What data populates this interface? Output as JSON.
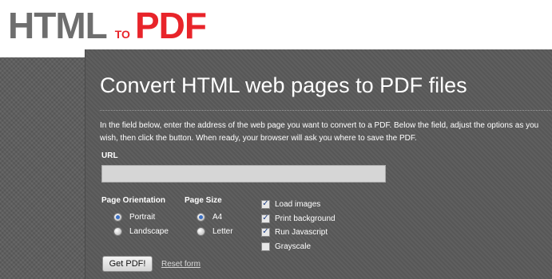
{
  "logo": {
    "html": "HTML",
    "to": "TO",
    "pdf": "PDF"
  },
  "main": {
    "title": "Convert HTML web pages to PDF files",
    "intro": "In the field below, enter the address of the web page you want to convert to a PDF. Below the field, adjust the options as you wish, then click the button. When ready, your browser will ask you where to save the PDF."
  },
  "form": {
    "url_label": "URL",
    "url_value": "",
    "orientation": {
      "label": "Page Orientation",
      "options": [
        {
          "label": "Portrait",
          "selected": true
        },
        {
          "label": "Landscape",
          "selected": false
        }
      ]
    },
    "size": {
      "label": "Page Size",
      "options": [
        {
          "label": "A4",
          "selected": true
        },
        {
          "label": "Letter",
          "selected": false
        }
      ]
    },
    "checkboxes": [
      {
        "label": "Load images",
        "checked": true
      },
      {
        "label": "Print background",
        "checked": true
      },
      {
        "label": "Run Javascript",
        "checked": true
      },
      {
        "label": "Grayscale",
        "checked": false
      }
    ],
    "submit_label": "Get PDF!",
    "reset_label": "Reset form"
  },
  "colors": {
    "logo_gray": "#6e6e6e",
    "logo_red": "#e8242a",
    "panel_bg": "#5a5a5a",
    "text": "#ffffff",
    "radio_selected": "#3a6fc4"
  }
}
